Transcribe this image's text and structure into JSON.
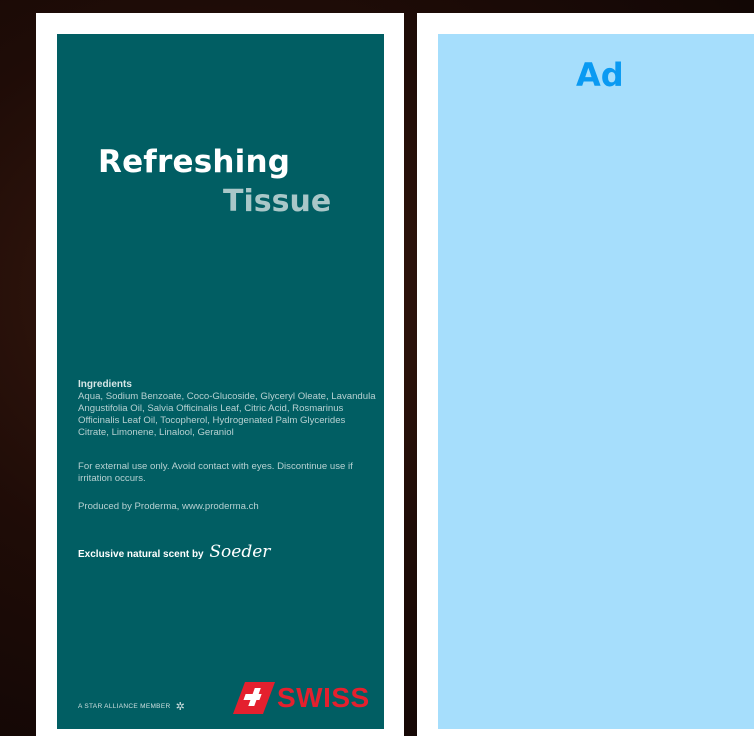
{
  "tissue": {
    "title_line1": "Refreshing",
    "title_line2": "Tissue",
    "ingredients_heading": "Ingredients",
    "ingredients_text": "Aqua, Sodium Benzoate, Coco-Glucoside, Glyceryl Oleate, Lavandula Angustifolia Oil, Salvia Officinalis Leaf, Citric Acid, Rosmarinus Officinalis Leaf Oil, Tocopherol, Hydrogenated Palm Glycerides Citrate, Limonene, Linalool, Geraniol",
    "warning_text": "For external use only. Avoid contact with eyes. Discontinue use if irritation occurs.",
    "produced_text": "Produced by Proderma, www.proderma.ch",
    "scent_text": "Exclusive natural scent by",
    "scent_brand": "Soeder",
    "star_alliance_text": "A STAR ALLIANCE MEMBER",
    "brand_name": "SWISS"
  },
  "ad": {
    "label": "Ad"
  },
  "colors": {
    "tissue_bg": "#015e63",
    "title_secondary": "#a9c7c8",
    "ad_bg": "#a6defc",
    "ad_text": "#0a9af2",
    "swiss_red": "#e4202e"
  },
  "icons": [
    "star-alliance-icon",
    "swiss-flag-icon"
  ]
}
